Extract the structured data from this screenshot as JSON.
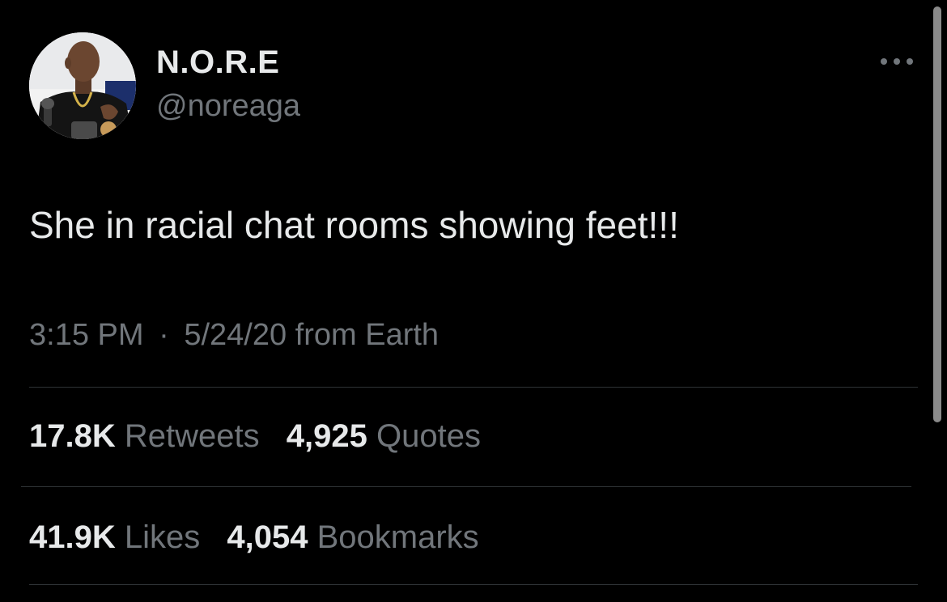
{
  "tweet": {
    "author": {
      "display_name": "N.O.R.E",
      "handle": "@noreaga"
    },
    "text": "She in racial chat rooms showing feet!!!",
    "meta": {
      "time": "3:15 PM",
      "separator": "·",
      "date": "5/24/20",
      "source": "from Earth"
    },
    "stats": {
      "retweets": {
        "count": "17.8K",
        "label": "Retweets"
      },
      "quotes": {
        "count": "4,925",
        "label": "Quotes"
      },
      "likes": {
        "count": "41.9K",
        "label": "Likes"
      },
      "bookmarks": {
        "count": "4,054",
        "label": "Bookmarks"
      }
    },
    "icons": {
      "more": "more-horizontal-icon"
    }
  },
  "colors": {
    "background": "#000000",
    "primary_text": "#e7e9ea",
    "secondary_text": "#71767b",
    "divider": "#2f3336"
  }
}
